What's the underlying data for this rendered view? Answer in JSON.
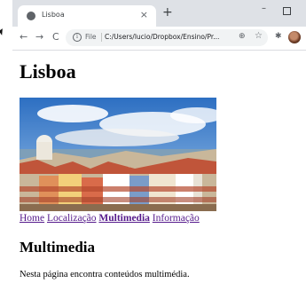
{
  "browser": {
    "tab_title": "Lisboa",
    "tab_close": "×",
    "new_tab": "+",
    "min": "–",
    "back": "←",
    "forward": "→",
    "reload": "C",
    "info": "i",
    "file_label": "File",
    "url": "C:/Users/lucio/Dropbox/Ensino/Pr...",
    "zoom": "⊕",
    "star": "☆",
    "extensions": "✱"
  },
  "page": {
    "title": "Lisboa",
    "nav": [
      {
        "label": "Home",
        "active": false
      },
      {
        "label": "Localização",
        "active": false
      },
      {
        "label": "Multimedia",
        "active": true
      },
      {
        "label": "Informação",
        "active": false
      }
    ],
    "section_title": "Multimedia",
    "paragraph": "Nesta página encontra conteúdos multimédia."
  }
}
